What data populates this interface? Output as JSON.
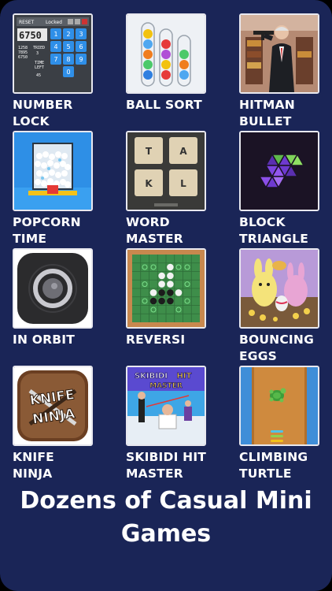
{
  "games": [
    {
      "label": "NUMBER\nLOCK",
      "icon": "number-lock-icon"
    },
    {
      "label": "BALL SORT",
      "icon": "ball-sort-icon"
    },
    {
      "label": "HITMAN\nBULLET",
      "icon": "hitman-bullet-icon"
    },
    {
      "label": "POPCORN\nTIME",
      "icon": "popcorn-time-icon"
    },
    {
      "label": "WORD\nMASTER",
      "icon": "word-master-icon"
    },
    {
      "label": "BLOCK\nTRIANGLE",
      "icon": "block-triangle-icon"
    },
    {
      "label": "IN ORBIT",
      "icon": "in-orbit-icon"
    },
    {
      "label": "REVERSI",
      "icon": "reversi-icon"
    },
    {
      "label": "BOUNCING\nEGGS",
      "icon": "bouncing-eggs-icon"
    },
    {
      "label": "KNIFE\nNINJA",
      "icon": "knife-ninja-icon"
    },
    {
      "label": "SKIBIDI HIT\nMASTER",
      "icon": "skibidi-hit-master-icon"
    },
    {
      "label": "CLIMBING\nTURTLE",
      "icon": "climbing-turtle-icon"
    }
  ],
  "number_lock": {
    "display": "6750",
    "reset": "RESET",
    "locked": "Locked",
    "keys": [
      "1",
      "2",
      "3",
      "4",
      "5",
      "6",
      "7",
      "8",
      "9",
      "0"
    ],
    "tries": [
      "1258",
      "7895",
      "6750"
    ],
    "tried": "TRIED",
    "tried_n": "3",
    "time_left": "TIME\nLEFT",
    "time_n": "45"
  },
  "word_master": {
    "letters": [
      "T",
      "A",
      "K",
      "L"
    ]
  },
  "knife_ninja": {
    "line1": "KNIFE",
    "line2": "NINJA"
  },
  "skibidi": {
    "line1": "SKIBIDI",
    "line2": "HIT",
    "line3": "MASTER"
  },
  "tagline": "Dozens of Casual Mini\nGames",
  "colors": {
    "background": "#1a2557",
    "text": "#ffffff",
    "tile_border": "#e8e8ef"
  }
}
